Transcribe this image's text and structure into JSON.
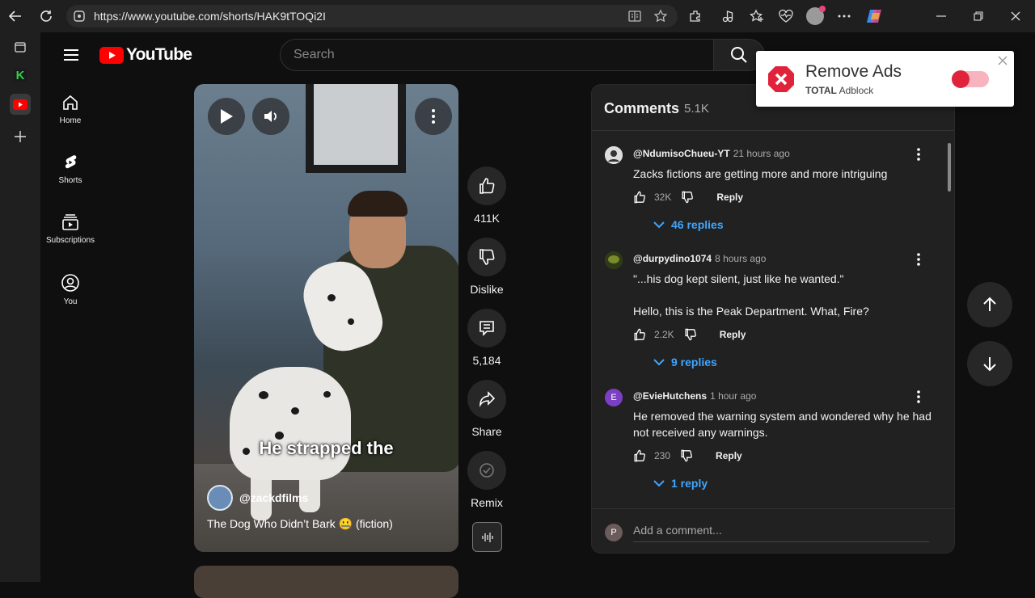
{
  "browser": {
    "url": "https://www.youtube.com/shorts/HAK9tTOQi2I"
  },
  "youtube": {
    "logo_text": "YouTube",
    "search_placeholder": "Search",
    "nav": [
      {
        "label": "Home",
        "icon": "home-icon"
      },
      {
        "label": "Shorts",
        "icon": "shorts-icon"
      },
      {
        "label": "Subscriptions",
        "icon": "subscriptions-icon"
      },
      {
        "label": "You",
        "icon": "account-icon"
      }
    ]
  },
  "video": {
    "caption": "He strapped the",
    "channel": "@zackdfilms",
    "title": "The Dog Who Didn’t Bark 🤐 (fiction)"
  },
  "actions": {
    "likes": "411K",
    "dislike_label": "Dislike",
    "comments": "5,184",
    "share_label": "Share",
    "remix_label": "Remix"
  },
  "comments": {
    "title": "Comments",
    "count": "5.1K",
    "items": [
      {
        "author": "@NdumisoChueu-YT",
        "time": "21 hours ago",
        "text": "Zacks fictions are getting more and more intriguing",
        "likes": "32K",
        "reply_label": "Reply",
        "replies": "46 replies",
        "avatar_color": "#e6e6e6"
      },
      {
        "author": "@durpydino1074",
        "time": "8 hours ago",
        "text": "\"...his dog kept silent, just like he wanted.\"",
        "text2": "Hello, this is the Peak Department. What, Fire?",
        "likes": "2.2K",
        "reply_label": "Reply",
        "replies": "9 replies",
        "avatar_color": "#5f6b2a"
      },
      {
        "author": "@EvieHutchens",
        "time": "1 hour ago",
        "text": "He removed the warning system and wondered why he had not received any warnings.",
        "likes": "230",
        "reply_label": "Reply",
        "replies": "1 reply",
        "avatar_letter": "E",
        "avatar_color": "#7b3fc4"
      }
    ],
    "input_placeholder": "Add a comment...",
    "user_initial": "P"
  },
  "ad_popup": {
    "title": "Remove Ads",
    "brand_bold": "TOTAL",
    "brand_rest": " Adblock",
    "colors": {
      "accent": "#e0233a"
    }
  },
  "colors": {
    "youtube_red": "#ff0000",
    "link_blue": "#3ea6ff"
  }
}
